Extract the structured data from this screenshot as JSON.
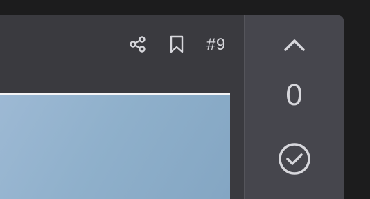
{
  "post": {
    "number_label": "#9",
    "vote_count": "0"
  },
  "icons": {
    "share": "share-icon",
    "bookmark": "bookmark-icon",
    "upvote": "chevron-up-icon",
    "accept": "check-circle-icon"
  },
  "colors": {
    "background": "#1c1c1d",
    "card": "#3a3a3f",
    "vote_panel": "#46464d",
    "text": "#d7d7dc",
    "image_blue": "#8fb0cb"
  }
}
